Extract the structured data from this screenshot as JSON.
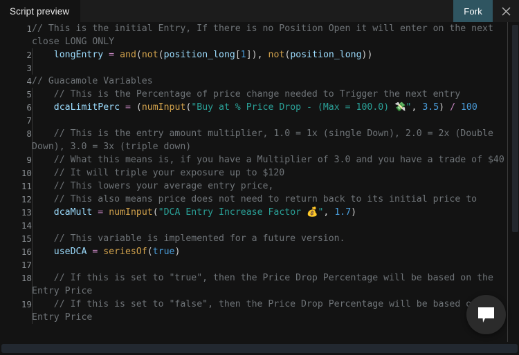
{
  "header": {
    "tab_label": "Script preview",
    "fork_label": "Fork",
    "close_icon": "close-icon"
  },
  "editor": {
    "chat_icon": "chat-bubble-icon",
    "lines": [
      {
        "number": "1",
        "guide": false,
        "tokens": [
          {
            "c": "cm",
            "t": "// This is the initial Entry, If there is no Position Open it will enter on the next close LONG ONLY"
          }
        ]
      },
      {
        "number": "2",
        "guide": true,
        "tokens": [
          {
            "c": "var",
            "t": "    longEntry "
          },
          {
            "c": "op",
            "t": "= "
          },
          {
            "c": "fn",
            "t": "and"
          },
          {
            "c": "pn",
            "t": "("
          },
          {
            "c": "fn",
            "t": "not"
          },
          {
            "c": "pn",
            "t": "("
          },
          {
            "c": "var",
            "t": "position_long"
          },
          {
            "c": "pn",
            "t": "["
          },
          {
            "c": "nu",
            "t": "1"
          },
          {
            "c": "pn",
            "t": "])"
          },
          {
            "c": "pn",
            "t": ", "
          },
          {
            "c": "fn",
            "t": "not"
          },
          {
            "c": "pn",
            "t": "("
          },
          {
            "c": "var",
            "t": "position_long"
          },
          {
            "c": "pn",
            "t": "))"
          }
        ]
      },
      {
        "number": "3",
        "guide": true,
        "tokens": []
      },
      {
        "number": "4",
        "guide": false,
        "tokens": [
          {
            "c": "cm",
            "t": "// Guacamole Variables"
          }
        ]
      },
      {
        "number": "5",
        "guide": true,
        "tokens": [
          {
            "c": "cm",
            "t": "    // This is the Percentage of price change needed to Trigger the next entry"
          }
        ]
      },
      {
        "number": "6",
        "guide": true,
        "tokens": [
          {
            "c": "var",
            "t": "    dcaLimitPerc "
          },
          {
            "c": "op",
            "t": "= "
          },
          {
            "c": "pn",
            "t": "("
          },
          {
            "c": "fn",
            "t": "numInput"
          },
          {
            "c": "pn",
            "t": "("
          },
          {
            "c": "st",
            "t": "\"Buy at % Price Drop - (Max = 100.0) "
          },
          {
            "c": "em",
            "t": "💸"
          },
          {
            "c": "st",
            "t": "\""
          },
          {
            "c": "pn",
            "t": ", "
          },
          {
            "c": "nu",
            "t": "3.5"
          },
          {
            "c": "pn",
            "t": ") "
          },
          {
            "c": "op",
            "t": "/ "
          },
          {
            "c": "nu",
            "t": "100"
          }
        ]
      },
      {
        "number": "7",
        "guide": true,
        "tokens": []
      },
      {
        "number": "8",
        "guide": true,
        "tokens": [
          {
            "c": "cm",
            "t": "    // This is the entry amount multiplier, 1.0 = 1x (single Down), 2.0 = 2x (Double Down), 3.0 = 3x (triple down)"
          }
        ]
      },
      {
        "number": "9",
        "guide": true,
        "tokens": [
          {
            "c": "cm",
            "t": "    // What this means is, if you have a Multiplier of 3.0 and you have a trade of $40"
          }
        ]
      },
      {
        "number": "10",
        "guide": true,
        "tokens": [
          {
            "c": "cm",
            "t": "    // It will triple your exposure up to $120"
          }
        ]
      },
      {
        "number": "11",
        "guide": true,
        "tokens": [
          {
            "c": "cm",
            "t": "    // This lowers your average entry price,"
          }
        ]
      },
      {
        "number": "12",
        "guide": true,
        "tokens": [
          {
            "c": "cm",
            "t": "    // This also means price does not need to return back to its initial price to"
          }
        ]
      },
      {
        "number": "13",
        "guide": true,
        "tokens": [
          {
            "c": "var",
            "t": "    dcaMult "
          },
          {
            "c": "op",
            "t": "= "
          },
          {
            "c": "fn",
            "t": "numInput"
          },
          {
            "c": "pn",
            "t": "("
          },
          {
            "c": "st",
            "t": "\"DCA Entry Increase Factor "
          },
          {
            "c": "em",
            "t": "💰"
          },
          {
            "c": "st",
            "t": "\""
          },
          {
            "c": "pn",
            "t": ", "
          },
          {
            "c": "nu",
            "t": "1.7"
          },
          {
            "c": "pn",
            "t": ")"
          }
        ]
      },
      {
        "number": "14",
        "guide": true,
        "tokens": []
      },
      {
        "number": "15",
        "guide": true,
        "tokens": [
          {
            "c": "cm",
            "t": "    // This variable is implemented for a future version."
          }
        ]
      },
      {
        "number": "16",
        "guide": true,
        "tokens": [
          {
            "c": "var",
            "t": "    useDCA "
          },
          {
            "c": "op",
            "t": "= "
          },
          {
            "c": "fn",
            "t": "seriesOf"
          },
          {
            "c": "pn",
            "t": "("
          },
          {
            "c": "kw",
            "t": "true"
          },
          {
            "c": "pn",
            "t": ")"
          }
        ]
      },
      {
        "number": "17",
        "guide": true,
        "tokens": []
      },
      {
        "number": "18",
        "guide": true,
        "tokens": [
          {
            "c": "cm",
            "t": "    // If this is set to \"true\", then the Price Drop Percentage will be based on the Entry Price"
          }
        ]
      },
      {
        "number": "19",
        "guide": true,
        "tokens": [
          {
            "c": "cm",
            "t": "    // If this is set to \"false\", then the Price Drop Percentage will be based on the Entry Price"
          }
        ]
      }
    ]
  },
  "colors": {
    "background": "#131313",
    "header_bg": "#1c1c1c",
    "fork_bg": "#2f5561",
    "comment": "#6f7478",
    "string": "#2aa198",
    "function": "#d2a24c",
    "number": "#4a9edc",
    "variable": "#9cdcfe",
    "operator": "#c586c0",
    "scrollbar": "#222830"
  }
}
